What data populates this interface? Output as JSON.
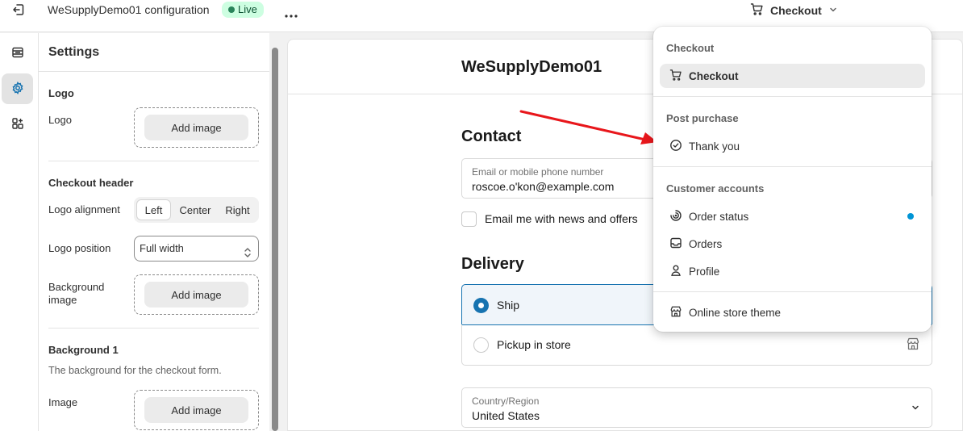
{
  "topbar": {
    "title": "WeSupplyDemo01 configuration",
    "status": "Live",
    "page_selector": "Checkout"
  },
  "icons": {
    "exit": "exit-icon",
    "more": "more-icon",
    "cart": "cart-icon",
    "sections": "sections-icon",
    "settings": "gear-icon",
    "apps": "apps-icon"
  },
  "settings": {
    "title": "Settings",
    "logo": {
      "section": "Logo",
      "label": "Logo",
      "button": "Add image"
    },
    "checkout_header": {
      "section": "Checkout header",
      "alignment_label": "Logo alignment",
      "alignment_options": [
        "Left",
        "Center",
        "Right"
      ],
      "alignment_selected": "Left",
      "position_label": "Logo position",
      "position_value": "Full width",
      "bg_image_label": "Background image",
      "bg_image_button": "Add image"
    },
    "background1": {
      "section": "Background 1",
      "description": "The background for the checkout form.",
      "image_label": "Image",
      "image_button": "Add image"
    }
  },
  "preview": {
    "store_name": "WeSupplyDemo01",
    "contact_heading": "Contact",
    "email_label": "Email or mobile phone number",
    "email_value": "roscoe.o'kon@example.com",
    "newsletter_label": "Email me with news and offers",
    "delivery_heading": "Delivery",
    "ship_label": "Ship",
    "pickup_label": "Pickup in store",
    "country_label": "Country/Region",
    "country_value": "United States"
  },
  "menu": {
    "checkout_section": "Checkout",
    "checkout_item": "Checkout",
    "post_purchase_section": "Post purchase",
    "thank_you_item": "Thank you",
    "customer_accounts_section": "Customer accounts",
    "order_status_item": "Order status",
    "orders_item": "Orders",
    "profile_item": "Profile",
    "online_store_item": "Online store theme"
  },
  "colors": {
    "accent": "#1773b0",
    "live_badge": "#cdfee1",
    "annotation_arrow": "#e8161b",
    "status_dot": "#0094d5"
  }
}
